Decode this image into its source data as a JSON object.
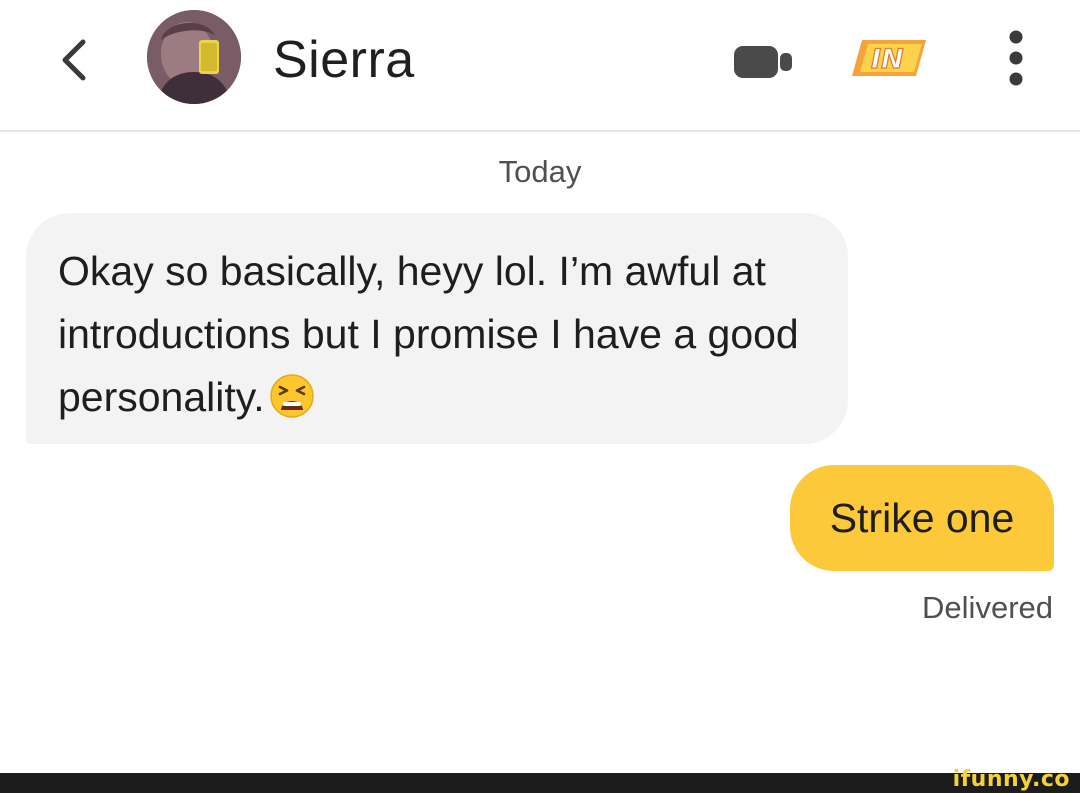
{
  "header": {
    "back_icon": "chevron-left-icon",
    "contact_name": "Sierra",
    "video_icon": "video-camera-icon",
    "boost_icon": "spotlight-badge-icon",
    "more_icon": "vertical-dots-icon"
  },
  "conversation": {
    "date_label": "Today",
    "messages": [
      {
        "direction": "incoming",
        "text": "Okay so basically, heyy lol. I’m awful at introductions but I promise I have a good personality.",
        "emoji": "tired-face-emoji"
      },
      {
        "direction": "outgoing",
        "text": "Strike one",
        "status": "Delivered"
      }
    ]
  },
  "watermark": {
    "text": "ifunny.co"
  },
  "colors": {
    "incoming_bubble": "#f3f3f3",
    "outgoing_bubble": "#fcc93a",
    "text": "#1e1e1e",
    "muted_text": "#505050"
  }
}
